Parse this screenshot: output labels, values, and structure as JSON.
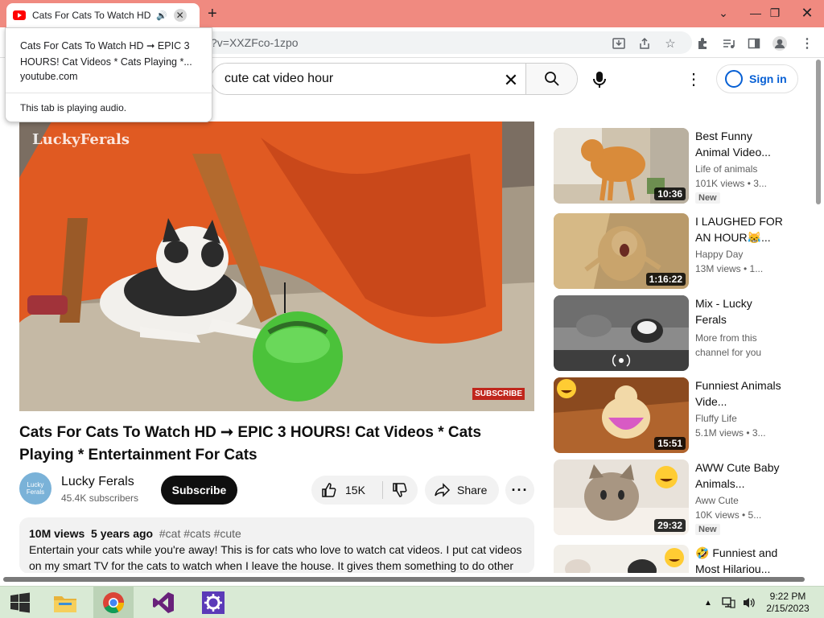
{
  "browser": {
    "tab_title": "Cats For Cats To Watch HD ➞",
    "url_fragment": "?v=XXZFco-1zpo",
    "audio_popup": {
      "title": "Cats For Cats To Watch HD ➞ EPIC 3 HOURS! Cat Videos * Cats Playing *...",
      "domain": "youtube.com",
      "note": "This tab is playing audio."
    }
  },
  "header": {
    "search_value": "cute cat video hour",
    "sign_in": "Sign in"
  },
  "video": {
    "watermark": "LuckyFerals",
    "subscribe_watermark": "SUBSCRIBE",
    "title": "Cats For Cats To Watch HD ➞ EPIC 3 HOURS! Cat Videos * Cats Playing * Entertainment For Cats",
    "channel": "Lucky Ferals",
    "subscribers": "45.4K subscribers",
    "subscribe_label": "Subscribe",
    "likes": "15K",
    "share_label": "Share",
    "description": {
      "views": "10M views",
      "age": "5 years ago",
      "tags": "#cat #cats #cute",
      "text": "Entertain your cats while you're away! This is for cats who love to watch cat videos. I put cat videos on my smart TV for the cats to watch when I leave the house. It gives them something to do other"
    }
  },
  "recommendations": [
    {
      "title": "Best Funny Animal Video...",
      "channel": "Life of animals",
      "views": "101K views • 3...",
      "duration": "10:36",
      "badge": "New"
    },
    {
      "title": "I LAUGHED FOR AN HOUR😹...",
      "channel": "Happy Day",
      "views": "13M views • 1...",
      "duration": "1:16:22",
      "badge": ""
    },
    {
      "title": "Mix - Lucky Ferals",
      "channel": "More from this channel for you",
      "views": "",
      "duration": "",
      "badge": ""
    },
    {
      "title": "Funniest Animals Vide...",
      "channel": "Fluffy Life",
      "views": "5.1M views • 3...",
      "duration": "15:51",
      "badge": ""
    },
    {
      "title": "AWW Cute Baby Animals...",
      "channel": "Aww Cute",
      "views": "10K views • 5...",
      "duration": "29:32",
      "badge": "New"
    },
    {
      "title": "🤣 Funniest and Most Hilariou...",
      "channel": "",
      "views": "",
      "duration": "",
      "badge": ""
    }
  ],
  "taskbar": {
    "time": "9:22 PM",
    "date": "2/15/2023"
  },
  "colors": {
    "tabstrip": "#f08a80",
    "youtube_red": "#ff0000",
    "signin_blue": "#065fd4"
  }
}
